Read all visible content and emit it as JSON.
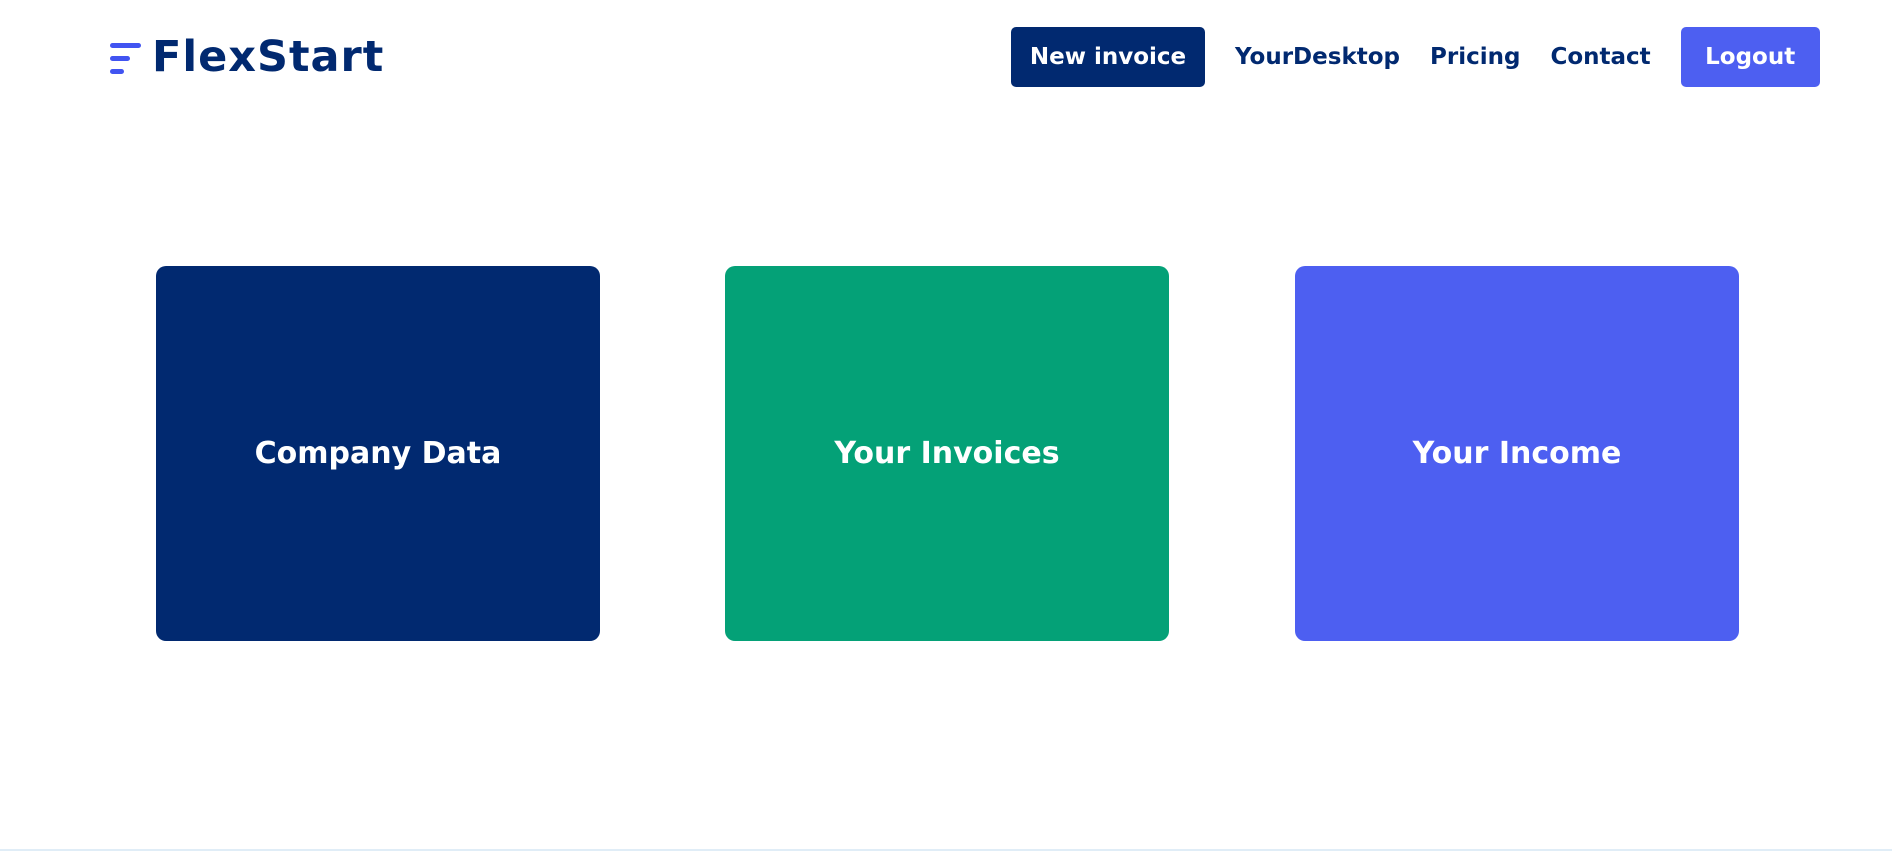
{
  "brand": {
    "name": "FlexStart",
    "logo_icon": "three-bar-lines-icon",
    "accent_color": "#4154f1",
    "primary_color": "#012970"
  },
  "nav": {
    "new_invoice_label": "New invoice",
    "your_desktop_label": "YourDesktop",
    "pricing_label": "Pricing",
    "contact_label": "Contact",
    "logout_label": "Logout"
  },
  "cards": [
    {
      "label": "Company Data",
      "color": "#012970"
    },
    {
      "label": "Your Invoices",
      "color": "#04a177"
    },
    {
      "label": "Your Income",
      "color": "#4d5ff1"
    }
  ]
}
